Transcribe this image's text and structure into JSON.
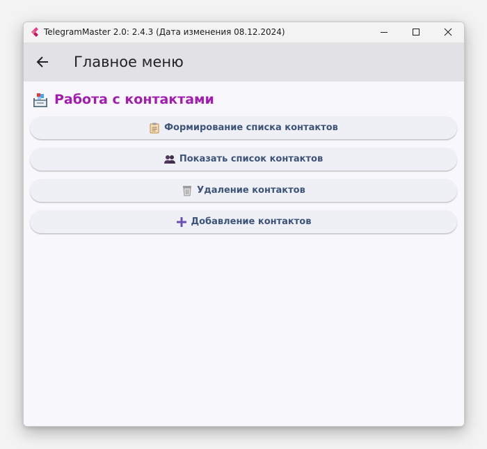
{
  "window": {
    "title": "TelegramMaster 2.0: 2.4.3 (Дата изменения 08.12.2024)"
  },
  "appbar": {
    "title": "Главное меню"
  },
  "section": {
    "title": "Работа с контактами"
  },
  "buttons": [
    {
      "label": "Формирование списка контактов",
      "icon": "clipboard-icon"
    },
    {
      "label": "Показать список контактов",
      "icon": "people-icon"
    },
    {
      "label": "Удаление контактов",
      "icon": "wastebasket-icon"
    },
    {
      "label": "Добавление контактов",
      "icon": "plus-icon"
    }
  ],
  "colors": {
    "section_title": "#a21caf",
    "button_text": "#3d5478",
    "appbar_bg": "#e2e2e6",
    "content_bg": "#f8f8fc",
    "button_bg": "#eff0f5"
  }
}
